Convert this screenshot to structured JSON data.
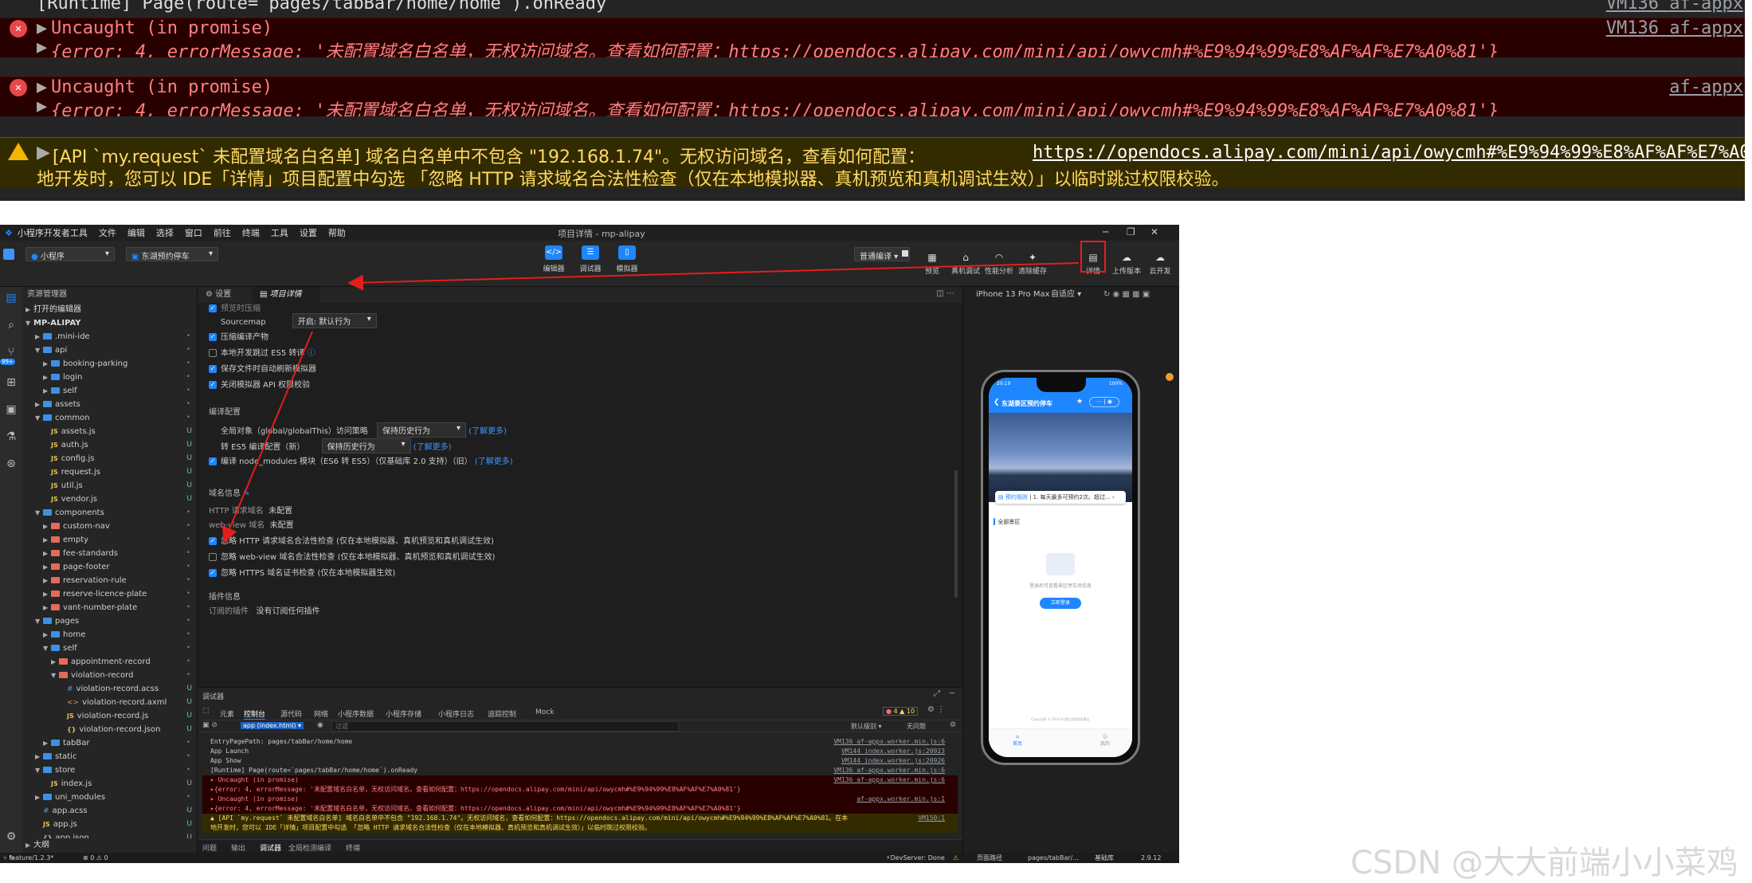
{
  "top_console": {
    "runtime_line": "[Runtime] Page(route=`pages/tabBar/home/home`).onReady",
    "runtime_src": "VM136 af-appx",
    "error1_title": "Uncaught (in promise)",
    "error1_src": "VM136 af-appx",
    "error1_detail": "{error: 4, errorMessage: '未配置域名白名单，无权访问域名。查看如何配置：https://opendocs.alipay.com/mini/api/owycmh#%E9%94%99%E8%AF%AF%E7%A0%81'}",
    "error2_title": "Uncaught (in promise)",
    "error2_src": "af-appx",
    "error2_detail": "{error: 4, errorMessage: '未配置域名白名单，无权访问域名。查看如何配置：https://opendocs.alipay.com/mini/api/owycmh#%E9%94%99%E8%AF%AF%E7%A0%81'}",
    "warn_line1": "[API `my.request` 未配置域名白名单] 域名白名单中不包含 \"192.168.1.74\"。无权访问域名，查看如何配置：",
    "warn_link": "https://opendocs.alipay.com/mini/api/owycmh#%E9%94%99%E8%AF%AF%E7%A0",
    "warn_line2": "地开发时，您可以 IDE「详情」项目配置中勾选 「忽略 HTTP 请求域名合法性检查（仅在本地模拟器、真机预览和真机调试生效）」以临时跳过权限校验。"
  },
  "ide": {
    "menu": [
      "小程序开发者工具",
      "文件",
      "编辑",
      "选择",
      "窗口",
      "前往",
      "终端",
      "工具",
      "设置",
      "帮助"
    ],
    "window_title": "项目详情 - mp-alipay",
    "toolbar": {
      "app_type": "小程序",
      "project": "东湖预约停车",
      "center_buttons": [
        "编辑器",
        "调试器",
        "模拟器"
      ],
      "compile_mode": "普通编译",
      "right_buttons": [
        "预览",
        "真机调试",
        "性能分析",
        "清除缓存",
        "详情",
        "上传版本",
        "云开发"
      ]
    },
    "explorer": {
      "title": "资源管理器",
      "open_editors": "打开的编辑器",
      "root": "MP-ALIPAY",
      "tree": [
        {
          "label": ".mini-ide",
          "type": "folder",
          "depth": 1,
          "open": false
        },
        {
          "label": "api",
          "type": "folder",
          "depth": 1,
          "open": true
        },
        {
          "label": "booking-parking",
          "type": "folder",
          "depth": 2,
          "open": false
        },
        {
          "label": "login",
          "type": "folder",
          "depth": 2,
          "open": false
        },
        {
          "label": "self",
          "type": "folder",
          "depth": 2,
          "open": false
        },
        {
          "label": "assets",
          "type": "folder",
          "depth": 1,
          "open": false
        },
        {
          "label": "common",
          "type": "folder",
          "depth": 1,
          "open": true
        },
        {
          "label": "assets.js",
          "type": "js",
          "depth": 2,
          "flag": "U"
        },
        {
          "label": "auth.js",
          "type": "js",
          "depth": 2,
          "flag": "U"
        },
        {
          "label": "config.js",
          "type": "js",
          "depth": 2,
          "flag": "U"
        },
        {
          "label": "request.js",
          "type": "js",
          "depth": 2,
          "flag": "U"
        },
        {
          "label": "util.js",
          "type": "js",
          "depth": 2,
          "flag": "U"
        },
        {
          "label": "vendor.js",
          "type": "js",
          "depth": 2,
          "flag": "U"
        },
        {
          "label": "components",
          "type": "folder",
          "depth": 1,
          "open": true
        },
        {
          "label": "custom-nav",
          "type": "folder-red",
          "depth": 2,
          "open": false
        },
        {
          "label": "empty",
          "type": "folder-red",
          "depth": 2,
          "open": false
        },
        {
          "label": "fee-standards",
          "type": "folder-red",
          "depth": 2,
          "open": false
        },
        {
          "label": "page-footer",
          "type": "folder-red",
          "depth": 2,
          "open": false
        },
        {
          "label": "reservation-rule",
          "type": "folder-red",
          "depth": 2,
          "open": false
        },
        {
          "label": "reserve-licence-plate",
          "type": "folder-red",
          "depth": 2,
          "open": false
        },
        {
          "label": "vant-number-plate",
          "type": "folder-red",
          "depth": 2,
          "open": false
        },
        {
          "label": "pages",
          "type": "folder",
          "depth": 1,
          "open": true
        },
        {
          "label": "home",
          "type": "folder",
          "depth": 2,
          "open": false
        },
        {
          "label": "self",
          "type": "folder",
          "depth": 2,
          "open": true
        },
        {
          "label": "appointment-record",
          "type": "folder-red",
          "depth": 3,
          "open": false
        },
        {
          "label": "violation-record",
          "type": "folder-red",
          "depth": 3,
          "open": true
        },
        {
          "label": "violation-record.acss",
          "type": "css",
          "depth": 4,
          "flag": "U"
        },
        {
          "label": "violation-record.axml",
          "type": "xml",
          "depth": 4,
          "flag": "U"
        },
        {
          "label": "violation-record.js",
          "type": "js",
          "depth": 4,
          "flag": "U"
        },
        {
          "label": "violation-record.json",
          "type": "json",
          "depth": 4,
          "flag": "U"
        },
        {
          "label": "tabBar",
          "type": "folder",
          "depth": 2,
          "open": false
        },
        {
          "label": "static",
          "type": "folder",
          "depth": 1,
          "open": false
        },
        {
          "label": "store",
          "type": "folder",
          "depth": 1,
          "open": true
        },
        {
          "label": "index.js",
          "type": "js",
          "depth": 2,
          "flag": "U"
        },
        {
          "label": "uni_modules",
          "type": "folder",
          "depth": 1,
          "open": false
        },
        {
          "label": "app.acss",
          "type": "css",
          "depth": 1,
          "flag": "U"
        },
        {
          "label": "app.js",
          "type": "js",
          "depth": 1,
          "flag": "U"
        },
        {
          "label": "app.json",
          "type": "json",
          "depth": 1,
          "flag": "U"
        }
      ],
      "outline": "大纲"
    },
    "editor": {
      "tabs": [
        "设置",
        "项目详情"
      ],
      "clipped_top": "预览时压缩",
      "sourcemap_label": "Sourcemap",
      "sourcemap_value": "开启: 默认行为",
      "checks": [
        {
          "label": "压缩编译产物",
          "checked": true
        },
        {
          "label": "本地开发跳过 ES5 转译",
          "checked": false
        },
        {
          "label": "保存文件时自动刷新模拟器",
          "checked": true
        },
        {
          "label": "关闭模拟器 API 权限校验",
          "checked": true
        }
      ],
      "compile_section": "编译配置",
      "global_label": "全局对象（global/globalThis）访问策略",
      "global_value": "保持历史行为",
      "learn_more": "(了解更多)",
      "es5_label": "转 ES5 编译配置（新）",
      "es5_value": "保持历史行为",
      "node_modules_label": "编译 node_modules 模块（ES6 转 ES5）（仅基础库 2.0 支持）（旧）",
      "domain_section": "域名信息",
      "http_label": "HTTP 请求域名",
      "http_value": "未配置",
      "webview_label": "web-view 域名",
      "webview_value": "未配置",
      "domain_checks": [
        {
          "label": "忽略 HTTP 请求域名合法性检查 (仅在本地模拟器、真机预览和真机调试生效)",
          "checked": true
        },
        {
          "label": "忽略 web-view 域名合法性检查 (仅在本地模拟器、真机预览和真机调试生效)",
          "checked": false
        },
        {
          "label": "忽略 HTTPS 域名证书检查 (仅在本地模拟器生效)",
          "checked": true
        }
      ],
      "plugin_section": "插件信息",
      "plugin_label": "订阅的插件",
      "plugin_value": "没有订阅任何插件"
    },
    "simulator": {
      "device": "iPhone 13 Pro Max",
      "fit": "自适应",
      "status_time": "20:19",
      "battery": "100%",
      "page_title": "东湖景区预约停车",
      "notice_tag": "预约规则",
      "notice_text": "1. 每天最多可预约2次。超过...",
      "scenic": "全部景区",
      "empty_text": "登录后可查看景区停车场信息",
      "login_button": "立即登录",
      "copyright": "Copyright © 2024 东湖生态旅游风景区",
      "tab_home": "首页",
      "tab_mine": "我的"
    },
    "debug": {
      "title": "调试器",
      "tabs": [
        "元素",
        "控制台",
        "源代码",
        "网络",
        "小程序数据",
        "小程序存储",
        "小程序日志",
        "追踪控制",
        "Mock"
      ],
      "active_tab": "控制台",
      "counts": "4 ▲ 10",
      "context": "app (index.html)",
      "filter_placeholder": "过滤",
      "level": "默认级别",
      "issues": "无问题",
      "logs": [
        {
          "text": "EntryPagePath: pages/tabBar/home/home",
          "src": "VM136 af-appx.worker.min.js:6",
          "kind": "info"
        },
        {
          "text": "App Launch",
          "src": "VM144 index.worker.js:20923",
          "kind": "info"
        },
        {
          "text": "App Show",
          "src": "VM144 index.worker.js:20926",
          "kind": "info"
        },
        {
          "text": "[Runtime] Page(route=`pages/tabBar/home/home`).onReady",
          "src": "VM136 af-appx.worker.min.js:6",
          "kind": "info"
        },
        {
          "text": "▸ Uncaught (in promise)",
          "src": "VM136 af-appx.worker.min.js:6",
          "kind": "err"
        },
        {
          "text": "  ▸{error: 4, errorMessage: '未配置域名白名单，无权访问域名。查看如何配置：https://opendocs.alipay.com/mini/api/owycmh#%E9%94%99%E8%AF%AF%E7%A0%81'}",
          "src": "",
          "kind": "err"
        },
        {
          "text": "▸ Uncaught (in promise)",
          "src": "af-appx.worker.min.js:1",
          "kind": "err"
        },
        {
          "text": "  ▸{error: 4, errorMessage: '未配置域名白名单，无权访问域名。查看如何配置：https://opendocs.alipay.com/mini/api/owycmh#%E9%94%99%E8%AF%AF%E7%A0%81'}",
          "src": "",
          "kind": "err"
        },
        {
          "text": "▲ [API `my.request` 未配置域名白名单] 域名白名单中不包含 \"192.168.1.74\"。无权访问域名，查看如何配置：https://opendocs.alipay.com/mini/api/owycmh#%E9%94%99%E8%AF%AF%E7%A0%81。在本",
          "src": "VM150:1",
          "kind": "warn"
        },
        {
          "text": "  地开发时，您可以 IDE「详情」项目配置中勾选 「忽略 HTTP 请求域名合法性检查（仅在本地模拟器、真机预览和真机调试生效）」以临时跳过权限校验。",
          "src": "",
          "kind": "warn"
        }
      ],
      "bottom_tabs": [
        "问题",
        "输出",
        "调试器",
        "全局检测",
        "编译",
        "终端"
      ],
      "bottom_active": "调试器"
    },
    "statusbar": {
      "branch": "feature/1.2.3*",
      "problems": "⊗ 0 ⚠ 0",
      "devserver": "DevServer: Done",
      "page_path": "页面路径",
      "page_value": "pages/tabBar/...",
      "lib": "基础库",
      "lib_version": "2.9.12"
    }
  },
  "watermark": "CSDN @大大前端小小菜鸡",
  "colors": {
    "accent": "#1e86ff",
    "error_bg": "#290000",
    "warn_bg": "#332b00",
    "annotation": "#e51d1d"
  }
}
